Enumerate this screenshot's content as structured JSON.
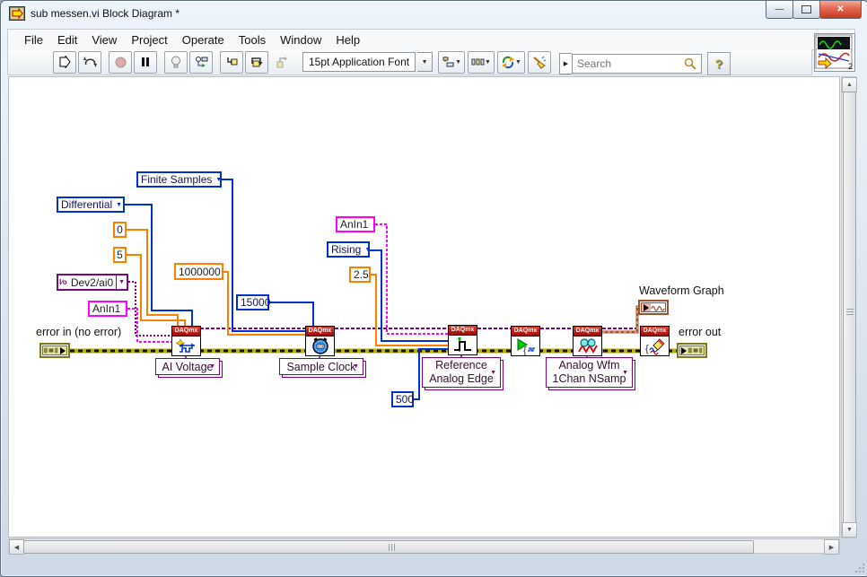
{
  "window": {
    "title": "sub messen.vi Block Diagram *",
    "minimize_glyph": "—",
    "close_glyph": "✕"
  },
  "menu": {
    "items": [
      "File",
      "Edit",
      "View",
      "Project",
      "Operate",
      "Tools",
      "Window",
      "Help"
    ]
  },
  "toolbar": {
    "font_selector": "15pt Application Font",
    "search": {
      "placeholder": "Search"
    },
    "help_label": "?",
    "vi_badge_count": "2"
  },
  "diagram": {
    "node_header": "DAQmx",
    "enums": {
      "finite_samples": "Finite Samples",
      "differential": "Differential",
      "rising": "Rising"
    },
    "numerics": {
      "zero": "0",
      "five": "5",
      "million": "1000000",
      "fifteen_k": "15000",
      "two_five": "2.5",
      "five_hundred": "500"
    },
    "strings": {
      "anin1_a": "AnIn1",
      "anin1_b": "AnIn1"
    },
    "io": {
      "device_channel": "Dev2/ai0",
      "glyph": "I∕o"
    },
    "selectors": {
      "create": "AI Voltage",
      "timing": "Sample Clock",
      "trigger_line1": "Reference",
      "trigger_line2": "Analog Edge",
      "read_line1": "Analog Wfm",
      "read_line2": "1Chan NSamp"
    },
    "labels": {
      "error_in": "error in (no error)",
      "error_out": "error out",
      "waveform_graph": "Waveform Graph"
    },
    "colors": {
      "daqmx_red": "#cc1111",
      "wire_blue": "#0033cc",
      "wire_orange": "#ff8000",
      "wire_magenta": "#ff00ff",
      "wire_purple": "#800080",
      "wire_error_olive": "#b8b000",
      "wire_brown": "#a0522d"
    }
  }
}
